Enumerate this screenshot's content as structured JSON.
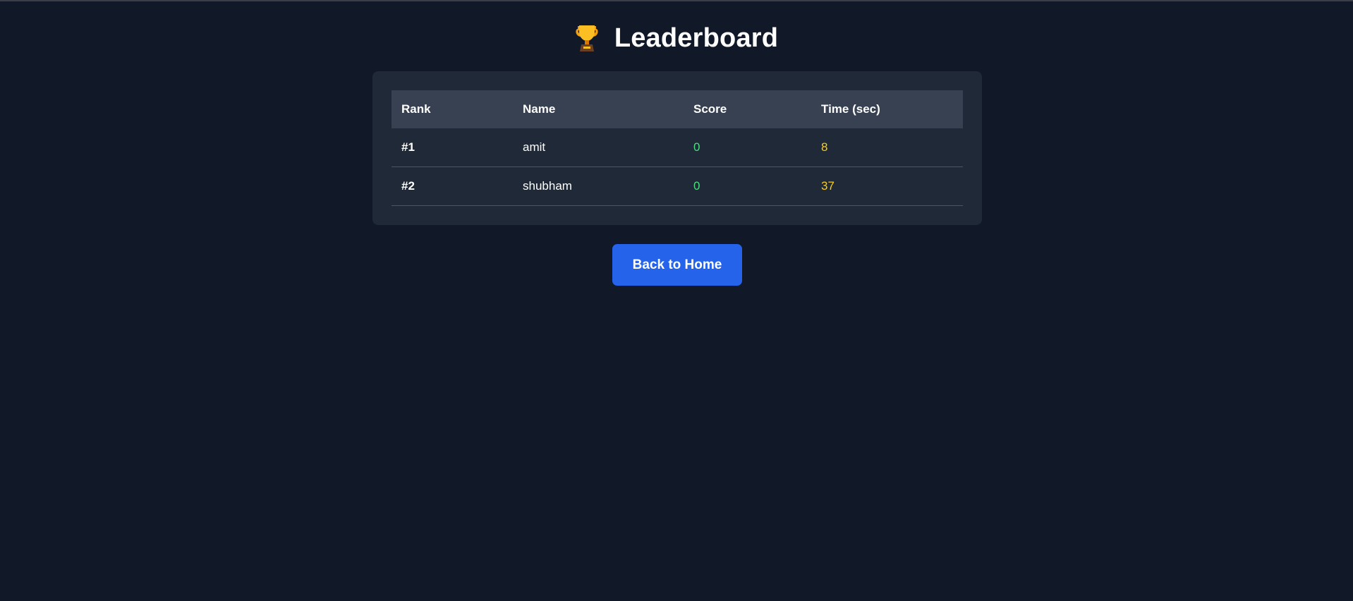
{
  "header": {
    "icon": "trophy-icon",
    "title": "Leaderboard"
  },
  "table": {
    "columns": [
      "Rank",
      "Name",
      "Score",
      "Time (sec)"
    ],
    "rows": [
      {
        "rank": "#1",
        "name": "amit",
        "score": "0",
        "time": "8"
      },
      {
        "rank": "#2",
        "name": "shubham",
        "score": "0",
        "time": "37"
      }
    ]
  },
  "actions": {
    "back_label": "Back to Home"
  },
  "colors": {
    "background": "#111827",
    "card": "#1f2937",
    "header_row": "#374151",
    "score": "#4ade80",
    "time": "#facc15",
    "button": "#2563eb"
  }
}
